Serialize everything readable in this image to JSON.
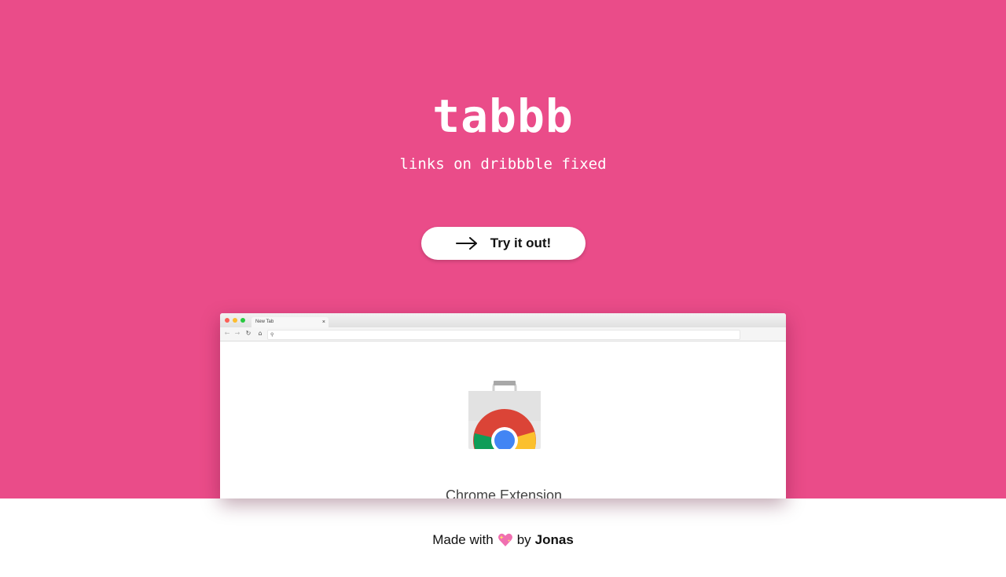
{
  "hero": {
    "title": "tabbb",
    "subtitle": "links on dribbble fixed",
    "background_color": "#ea4c89",
    "cta_label": "Try it out!",
    "cta_icon": "arrow-right-icon"
  },
  "browser_mockup": {
    "tab_title": "New Tab",
    "tab_close": "×",
    "nav_icons": [
      "back-icon",
      "forward-icon",
      "reload-icon",
      "home-icon",
      "search-icon"
    ],
    "store_icon": "chrome-web-store-icon",
    "caption": "Chrome Extension"
  },
  "footer": {
    "prefix": "Made with",
    "heart_icon": "sparkling-heart-icon",
    "by": "by",
    "author": "Jonas"
  }
}
